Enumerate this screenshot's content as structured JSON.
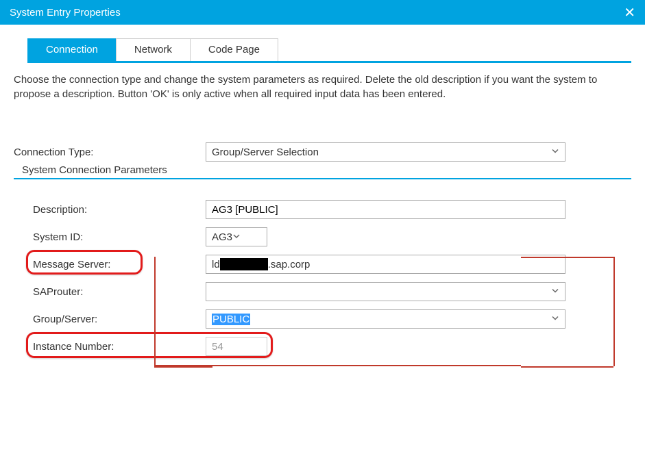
{
  "window": {
    "title": "System Entry Properties"
  },
  "tabs": {
    "connection": "Connection",
    "network": "Network",
    "codepage": "Code Page"
  },
  "instructions": "Choose the connection type and change the system parameters as required. Delete the old description if you want the system to propose a description. Button 'OK' is only active when all required input data has been entered.",
  "labels": {
    "connection_type": "Connection Type:",
    "group_title": "System Connection Parameters",
    "description": "Description:",
    "system_id": "System ID:",
    "message_server": "Message Server:",
    "saprouter": "SAProuter:",
    "group_server": "Group/Server:",
    "instance_number": "Instance Number:"
  },
  "values": {
    "connection_type": "Group/Server Selection",
    "description": "AG3 [PUBLIC]",
    "system_id": "AG3",
    "message_server_prefix": "ld",
    "message_server_suffix": ".sap.corp",
    "saprouter": "",
    "group_server": "PUBLIC",
    "instance_number": "54"
  }
}
